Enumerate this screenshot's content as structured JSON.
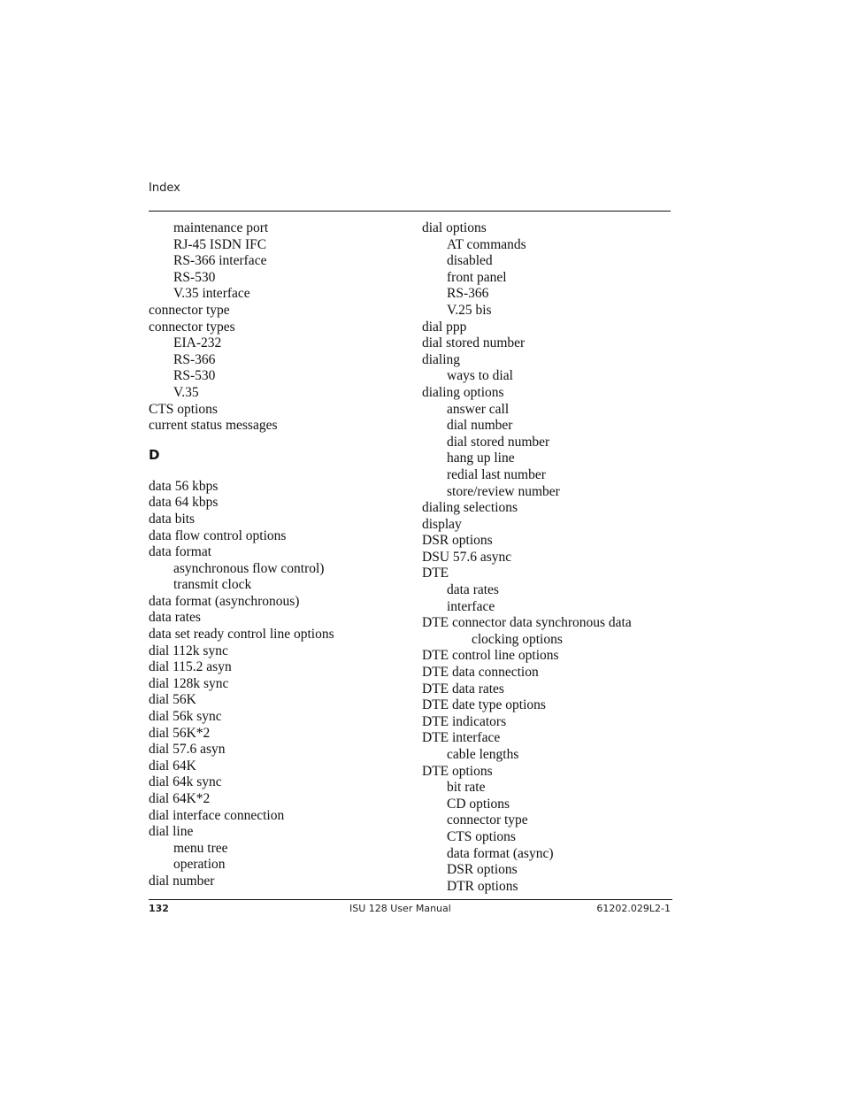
{
  "header": {
    "section_label": "Index"
  },
  "left_column": {
    "entries_before": [
      {
        "text": "maintenance port",
        "level": 1
      },
      {
        "text": "RJ-45 ISDN IFC",
        "level": 1
      },
      {
        "text": "RS-366 interface",
        "level": 1
      },
      {
        "text": "RS-530",
        "level": 1
      },
      {
        "text": "V.35 interface",
        "level": 1
      },
      {
        "text": "connector type",
        "level": 0
      },
      {
        "text": "connector types",
        "level": 0
      },
      {
        "text": "EIA-232",
        "level": 1
      },
      {
        "text": "RS-366",
        "level": 1
      },
      {
        "text": "RS-530",
        "level": 1
      },
      {
        "text": "V.35",
        "level": 1
      },
      {
        "text": "CTS options",
        "level": 0
      },
      {
        "text": "current status messages",
        "level": 0
      }
    ],
    "section_letter": "D",
    "entries_after": [
      {
        "text": "data 56 kbps",
        "level": 0
      },
      {
        "text": "data 64 kbps",
        "level": 0
      },
      {
        "text": "data bits",
        "level": 0
      },
      {
        "text": "data flow control options",
        "level": 0
      },
      {
        "text": "data format",
        "level": 0
      },
      {
        "text": "asynchronous flow control)",
        "level": 1
      },
      {
        "text": "transmit clock",
        "level": 1
      },
      {
        "text": "data format (asynchronous)",
        "level": 0
      },
      {
        "text": "data rates",
        "level": 0
      },
      {
        "text": "data set ready control line options",
        "level": 0
      },
      {
        "text": "dial 112k sync",
        "level": 0
      },
      {
        "text": "dial 115.2 asyn",
        "level": 0
      },
      {
        "text": "dial 128k sync",
        "level": 0
      },
      {
        "text": "dial 56K",
        "level": 0
      },
      {
        "text": "dial 56k sync",
        "level": 0
      },
      {
        "text": "dial 56K*2",
        "level": 0
      },
      {
        "text": "dial 57.6 asyn",
        "level": 0
      },
      {
        "text": "dial 64K",
        "level": 0
      },
      {
        "text": "dial 64k sync",
        "level": 0
      },
      {
        "text": "dial 64K*2",
        "level": 0
      },
      {
        "text": "dial interface connection",
        "level": 0
      },
      {
        "text": "dial line",
        "level": 0
      },
      {
        "text": "menu tree",
        "level": 1
      },
      {
        "text": "operation",
        "level": 1
      },
      {
        "text": "dial number",
        "level": 0
      }
    ]
  },
  "right_column": {
    "entries": [
      {
        "text": "dial options",
        "level": 0
      },
      {
        "text": "AT commands",
        "level": 1
      },
      {
        "text": "disabled",
        "level": 1
      },
      {
        "text": "front panel",
        "level": 1
      },
      {
        "text": "RS-366",
        "level": 1
      },
      {
        "text": "V.25 bis",
        "level": 1
      },
      {
        "text": "dial ppp",
        "level": 0
      },
      {
        "text": "dial stored number",
        "level": 0
      },
      {
        "text": "dialing",
        "level": 0
      },
      {
        "text": "ways to dial",
        "level": 1
      },
      {
        "text": "dialing options",
        "level": 0
      },
      {
        "text": "answer call",
        "level": 1
      },
      {
        "text": "dial number",
        "level": 1
      },
      {
        "text": "dial stored number",
        "level": 1
      },
      {
        "text": "hang up line",
        "level": 1
      },
      {
        "text": "redial last number",
        "level": 1
      },
      {
        "text": "store/review number",
        "level": 1
      },
      {
        "text": "dialing selections",
        "level": 0
      },
      {
        "text": "display",
        "level": 0
      },
      {
        "text": "DSR options",
        "level": 0
      },
      {
        "text": "DSU 57.6 async",
        "level": 0
      },
      {
        "text": "DTE",
        "level": 0
      },
      {
        "text": "data rates",
        "level": 1
      },
      {
        "text": "interface",
        "level": 1
      },
      {
        "text": "DTE connector data synchronous data",
        "level": 0
      },
      {
        "text": "clocking options",
        "level": 2
      },
      {
        "text": "DTE control line options",
        "level": 0
      },
      {
        "text": "DTE data connection",
        "level": 0
      },
      {
        "text": "DTE data rates",
        "level": 0
      },
      {
        "text": "DTE date type options",
        "level": 0
      },
      {
        "text": "DTE indicators",
        "level": 0
      },
      {
        "text": "DTE interface",
        "level": 0
      },
      {
        "text": "cable lengths",
        "level": 1
      },
      {
        "text": "DTE options",
        "level": 0
      },
      {
        "text": "bit rate",
        "level": 1
      },
      {
        "text": "CD options",
        "level": 1
      },
      {
        "text": "connector type",
        "level": 1
      },
      {
        "text": "CTS options",
        "level": 1
      },
      {
        "text": "data format (async)",
        "level": 1
      },
      {
        "text": "DSR options",
        "level": 1
      },
      {
        "text": "DTR options",
        "level": 1
      }
    ]
  },
  "footer": {
    "page_number": "132",
    "manual_title": "ISU 128 User Manual",
    "document_number": "61202.029L2-1"
  }
}
